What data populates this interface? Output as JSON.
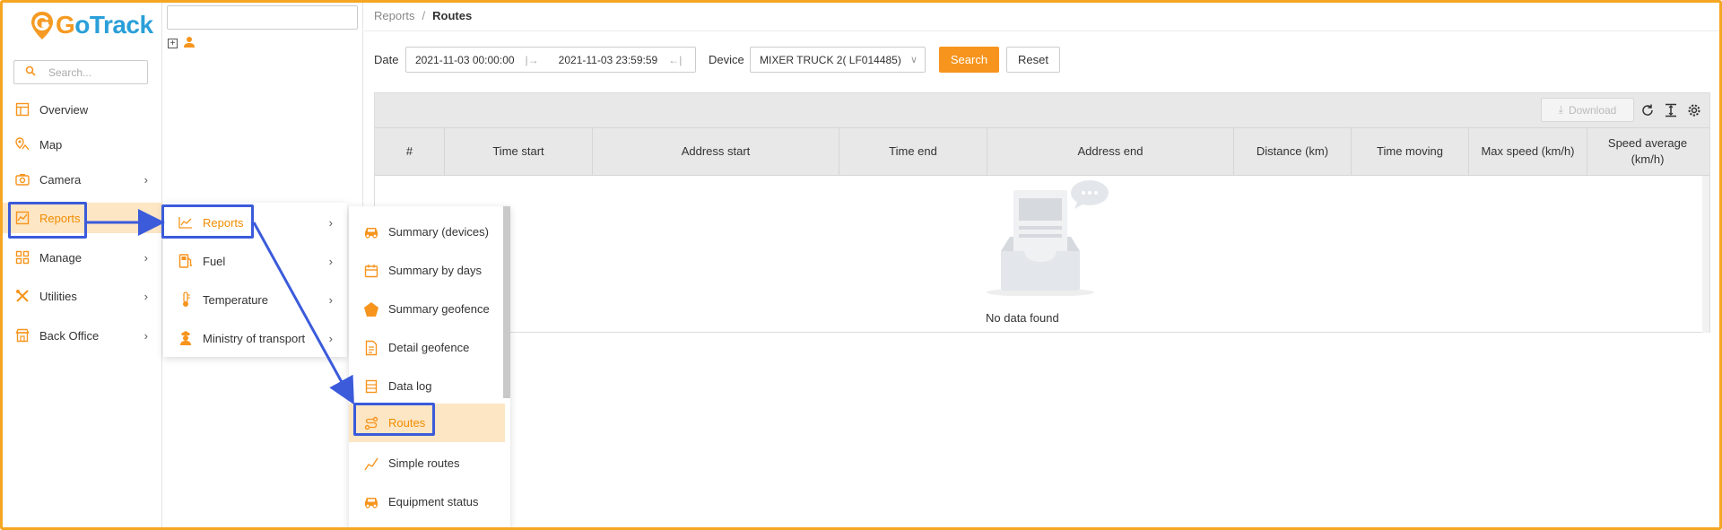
{
  "app": {
    "logo_text_1": "G",
    "logo_text_2": "oTrack"
  },
  "sidebar": {
    "search_placeholder": "Search...",
    "items": [
      {
        "label": "Overview",
        "icon": "overview-icon",
        "has_submenu": false
      },
      {
        "label": "Map",
        "icon": "map-icon",
        "has_submenu": false
      },
      {
        "label": "Camera",
        "icon": "camera-icon",
        "has_submenu": true
      },
      {
        "label": "Reports",
        "icon": "chart-icon",
        "has_submenu": true,
        "active": true
      },
      {
        "label": "Manage",
        "icon": "grid-icon",
        "has_submenu": true
      },
      {
        "label": "Utilities",
        "icon": "tools-icon",
        "has_submenu": true
      },
      {
        "label": "Back Office",
        "icon": "store-icon",
        "has_submenu": true
      }
    ]
  },
  "reports_menu": {
    "items": [
      {
        "label": "Reports",
        "icon": "line-chart-icon",
        "active": true
      },
      {
        "label": "Fuel",
        "icon": "fuel-icon"
      },
      {
        "label": "Temperature",
        "icon": "thermometer-icon"
      },
      {
        "label": "Ministry of transport",
        "icon": "officer-icon"
      }
    ]
  },
  "reports_submenu": {
    "items": [
      {
        "label": "Summary (devices)",
        "icon": "car-icon"
      },
      {
        "label": "Summary by days",
        "icon": "calendar-icon"
      },
      {
        "label": "Summary geofence",
        "icon": "pentagon-icon"
      },
      {
        "label": "Detail geofence",
        "icon": "document-icon"
      },
      {
        "label": "Data log",
        "icon": "list-icon"
      },
      {
        "label": "Routes",
        "icon": "route-icon",
        "active": true
      },
      {
        "label": "Simple routes",
        "icon": "trend-icon"
      },
      {
        "label": "Equipment status",
        "icon": "car-icon"
      }
    ]
  },
  "breadcrumb": {
    "parent": "Reports",
    "separator": "/",
    "current": "Routes"
  },
  "filters": {
    "date_label": "Date",
    "date_start": "2021-11-03 00:00:00",
    "date_end": "2021-11-03 23:59:59",
    "device_label": "Device",
    "device_value": "MIXER TRUCK 2( LF014485)",
    "search_label": "Search",
    "reset_label": "Reset"
  },
  "toolbar": {
    "download_label": "Download"
  },
  "table": {
    "columns": [
      "#",
      "Time start",
      "Address start",
      "Time end",
      "Address end",
      "Distance (km)",
      "Time moving",
      "Max speed (km/h)",
      "Speed average (km/h)"
    ],
    "rows": [],
    "empty_text": "No data found"
  },
  "colors": {
    "accent": "#f7941d",
    "highlight": "#3b5bdb",
    "active_bg": "#fde6c4"
  }
}
